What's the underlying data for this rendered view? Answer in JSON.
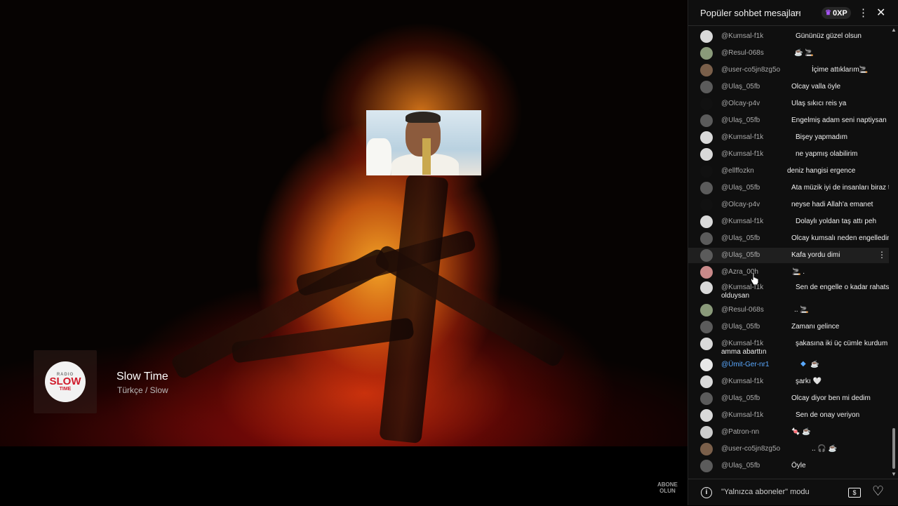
{
  "station": {
    "name": "Slow Time",
    "genre": "Türkçe / Slow",
    "logo_top": "RADIO",
    "logo_main": "SLOW",
    "logo_sub": "TIME"
  },
  "watermark": {
    "line1": "ABONE",
    "line2": "OLUN"
  },
  "chat": {
    "title": "Popüler sohbet mesajları",
    "xp": "0XP",
    "footer_mode": "\"Yalnızca aboneler\" modu",
    "messages": [
      {
        "author": "@Kumsal-f1k",
        "text": "Gününüz güzel olsun",
        "avatar": "#d9d9d9"
      },
      {
        "author": "@Resul-068s",
        "text": "☕ 🚬",
        "avatar": "#8a9a7a"
      },
      {
        "author": "@user-co5jn8zg5o",
        "text": "İçime attıklarım🚬",
        "avatar": "#7a5f4a"
      },
      {
        "author": "@Ulaş_05fb",
        "text": "Olcay valla öyle",
        "avatar": "#5b5b5b"
      },
      {
        "author": "@Olcay-p4v",
        "text": "Ulaş sıkıcı reis ya",
        "avatar": "#111111"
      },
      {
        "author": "@Ulaş_05fb",
        "text": "Engelmiş adam seni naptiysan",
        "avatar": "#5b5b5b"
      },
      {
        "author": "@Kumsal-f1k",
        "text": "Bişey yapmadım",
        "avatar": "#d9d9d9"
      },
      {
        "author": "@Kumsal-f1k",
        "text": "ne yapmış olabilirim",
        "avatar": "#d9d9d9"
      },
      {
        "author": "@ellffozkn",
        "text": "deniz hangisi ergence",
        "avatar": "#111111"
      },
      {
        "author": "@Ulaş_05fb",
        "text": "Ata müzik iyi de insanları biraz tuhaf",
        "avatar": "#5b5b5b"
      },
      {
        "author": "@Olcay-p4v",
        "text": "neyse hadi Allah'a emanet",
        "avatar": "#111111"
      },
      {
        "author": "@Kumsal-f1k",
        "text": "Dolaylı yoldan taş attı peh",
        "avatar": "#d9d9d9"
      },
      {
        "author": "@Ulaş_05fb",
        "text": "Olcay kumsalı neden engelledin reis",
        "avatar": "#5b5b5b"
      },
      {
        "author": "@Ulaş_05fb",
        "text": "Kafa yordu dimi",
        "avatar": "#5b5b5b"
      },
      {
        "author": "@Azra_00h",
        "text": "🚬 .",
        "avatar": "#c98a8a"
      },
      {
        "author": "@Kumsal-f1k",
        "text": "Sen de engelle o kadar rahatsız",
        "text2": "olduysan",
        "avatar": "#d9d9d9"
      },
      {
        "author": "@Resul-068s",
        "text": ".. 🚬",
        "avatar": "#8a9a7a"
      },
      {
        "author": "@Ulaş_05fb",
        "text": "Zamanı gelince",
        "avatar": "#5b5b5b"
      },
      {
        "author": "@Kumsal-f1k",
        "text": "şakasına iki üç cümle kurdum",
        "text2": "amma abarttın",
        "avatar": "#d9d9d9"
      },
      {
        "author": "@Ümit-Ger-nr1",
        "text": "☕",
        "avatar": "#e8e8e8",
        "member": true
      },
      {
        "author": "@Kumsal-f1k",
        "text": "şarkı 🤍",
        "avatar": "#d9d9d9"
      },
      {
        "author": "@Ulaş_05fb",
        "text": "Olcay diyor ben mi dedim",
        "avatar": "#5b5b5b"
      },
      {
        "author": "@Kumsal-f1k",
        "text": "Sen de onay veriyon",
        "avatar": "#d9d9d9"
      },
      {
        "author": "@Patron-nn",
        "text": "🍬 ☕",
        "avatar": "#cccccc"
      },
      {
        "author": "@user-co5jn8zg5o",
        "text": ".. 🎧 ☕",
        "avatar": "#7a5f4a"
      },
      {
        "author": "@Ulaş_05fb",
        "text": "Öyle",
        "avatar": "#5b5b5b"
      }
    ]
  }
}
